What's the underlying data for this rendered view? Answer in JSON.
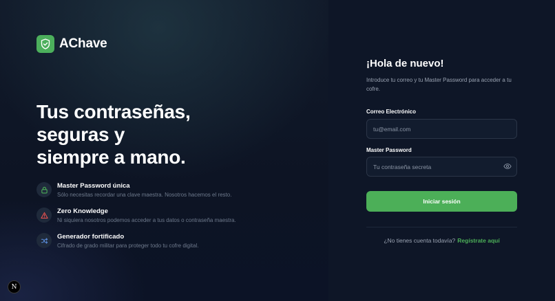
{
  "brand": {
    "name": "AChave",
    "icon": "shield-check-icon",
    "accent": "#4caf58"
  },
  "hero": {
    "lines": [
      "Tus contraseñas,",
      "seguras y",
      "siempre a mano."
    ]
  },
  "features": [
    {
      "icon": "lock-icon",
      "icon_color": "#4caf58",
      "title": "Master Password única",
      "desc": "Sólo necesitas recordar una clave maestra. Nosotros hacemos el resto."
    },
    {
      "icon": "warning-triangle-icon",
      "icon_color": "#e0504f",
      "title": "Zero Knowledge",
      "desc": "Ni siquiera nosotros podemos acceder a tus datos o contraseña maestra."
    },
    {
      "icon": "shuffle-icon",
      "icon_color": "#5b8fe0",
      "title": "Generador fortificado",
      "desc": "Cifrado de grado militar para proteger todo tu cofre digital."
    }
  ],
  "form": {
    "title": "¡Hola de nuevo!",
    "subtitle": "Introduce tu correo y tu Master Password para acceder a tu cofre.",
    "email_label": "Correo Electrónico",
    "email_placeholder": "tu@email.com",
    "password_label": "Master Password",
    "password_placeholder": "Tu contraseña secreta",
    "submit_label": "Iniciar sesión",
    "signup_prompt": "¿No tienes cuenta todavía?",
    "signup_link": "Regístrate aquí"
  },
  "next_badge": "N"
}
